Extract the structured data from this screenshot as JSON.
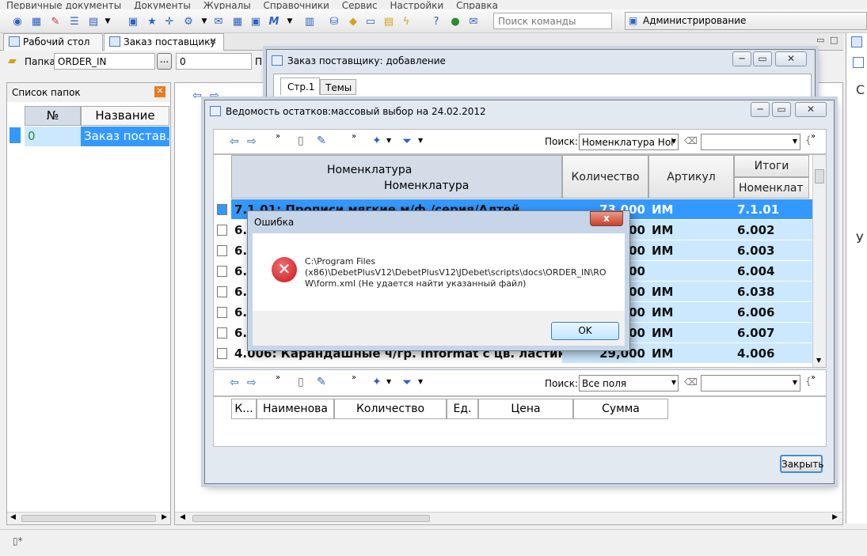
{
  "menu": [
    "Первичные документы",
    "Документы",
    "Журналы",
    "Справочники",
    "Сервис",
    "Настройки",
    "Справка"
  ],
  "toolbar": {
    "search_placeholder": "Поиск команды",
    "role": "Администрирование"
  },
  "tabs": [
    {
      "label": "Рабочий стол"
    },
    {
      "label": "Заказ поставщику"
    }
  ],
  "folder_bar": {
    "label": "Папка",
    "value": "ORDER_IN",
    "browse": "...",
    "num_value": "0",
    "trailing": "П"
  },
  "folders_panel": {
    "title": "Список папок",
    "col_num": "№",
    "col_name": "Название",
    "row_num": "0",
    "row_name": "Заказ постав..."
  },
  "order_window": {
    "title": "Заказ поставщику: добавление",
    "tab1": "Стр.1",
    "tab2": "Темы"
  },
  "stock_window": {
    "title": "Ведомость остатков:массовый выбор на 24.02.2012",
    "search_label": "Поиск:",
    "search_mode": "Номенклатура Ноі",
    "hdr_nom_group": "Номенклатура",
    "hdr_nom": "Номенклатура",
    "hdr_qty": "Количество",
    "hdr_art": "Артикул",
    "hdr_totals": "Итоги",
    "hdr_nom_short": "Номенклат",
    "rows": [
      {
        "name": "7.1.01: Прописи мягкие м/ф./серия/Алтей",
        "qty": "73,000",
        "art": "ИМ",
        "code": "7.1.01"
      },
      {
        "name": "6.0",
        "qty": "00",
        "art": "ИМ",
        "code": "6.002"
      },
      {
        "name": "6.0",
        "qty": "00",
        "art": "ИМ",
        "code": "6.003"
      },
      {
        "name": "6.0",
        "qty": "00",
        "art": "",
        "code": "6.004"
      },
      {
        "name": "6.0",
        "qty": "00",
        "art": "ИМ",
        "code": "6.038"
      },
      {
        "name": "6.0",
        "qty": "00",
        "art": "ИМ",
        "code": "6.006"
      },
      {
        "name": "6.0",
        "qty": "00",
        "art": "ИМ",
        "code": "6.007"
      },
      {
        "name": "4.006: Карандашные ч/гр. Informat с цв. ластиком",
        "qty": "29,000",
        "art": "ИМ",
        "code": "4.006"
      }
    ],
    "lower_search_label": "Поиск:",
    "lower_search_mode": "Все поля",
    "lower_cols": [
      "К...",
      "Наименова",
      "Количество",
      "Ед.",
      "Цена",
      "Сумма"
    ],
    "close_btn": "Закрыть"
  },
  "error_dialog": {
    "title": "Ошибка",
    "close": "x",
    "line1": "C:\\Program Files",
    "line2": "(x86)\\DebetPlusV12\\DebetPlusV12\\JDebet\\scripts\\docs\\ORDER_IN\\RO",
    "line3": "W\\form.xml (Не удается найти указанный файл)",
    "ok": "OK"
  },
  "right_panel": {
    "c1": "С",
    "c2": "У"
  },
  "colors": {
    "selection": "#3399ff",
    "row_blue": "#cce8ff",
    "error_red": "#d8262b"
  }
}
